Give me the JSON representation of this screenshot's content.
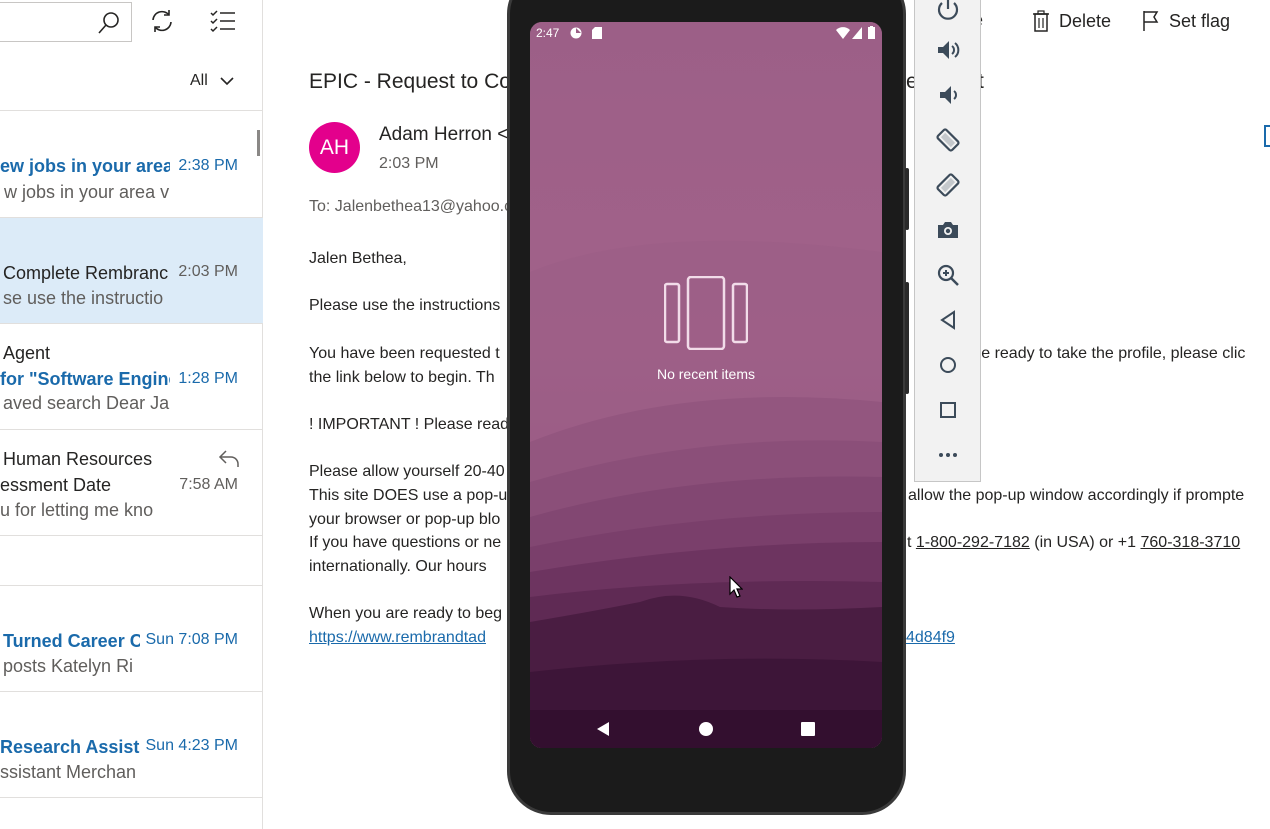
{
  "toolbar": {
    "commands": [
      {
        "label": "ve",
        "icon": "archive-icon"
      },
      {
        "label": "Delete",
        "icon": "trash-icon"
      },
      {
        "label": "Set flag",
        "icon": "flag-icon"
      }
    ]
  },
  "mail_list": {
    "filter_label": "All",
    "items": [
      {
        "line1": "ew jobs in your area",
        "time": "2:38 PM",
        "line2": "w jobs in your area v"
      },
      {
        "line1": "Complete Rembranc",
        "time": "2:03 PM",
        "line2": "se use the instructio",
        "selected": true
      },
      {
        "line0": "Agent",
        "line1": "for \"Software Engine",
        "time": "1:28 PM",
        "line2": "aved search Dear Jale"
      },
      {
        "line0": "Human Resources",
        "line1": "essment Date",
        "time": "7:58 AM",
        "line2": "u for letting me kno"
      },
      {
        "line1": "Turned Career C",
        "time": "Sun 7:08 PM",
        "line2": "posts Katelyn Ri"
      },
      {
        "line1": "Research Assistar",
        "time": "Sun 4:23 PM",
        "line2": "ssistant Merchan"
      }
    ]
  },
  "message": {
    "title": "EPIC - Request to Co",
    "title_tail": "e",
    "title_end": "t",
    "avatar_initials": "AH",
    "from_name": "Adam Herron",
    "from_suffix": "<",
    "time": "2:03 PM",
    "to_label": "To:",
    "to_address": "Jalenbethea13@yahoo.c",
    "greeting": "Jalen Bethea,",
    "p1": "Please use the instructions",
    "p2a": "You have been requested t",
    "p2a_right": "are ready to take the profile, please clic",
    "p2b": "the link below to begin. Th",
    "important": "! IMPORTANT ! Please read",
    "p3a": "Please allow yourself 20-40",
    "p3b": "This site DOES use a pop-u",
    "p3b_right": "allow the pop-up window accordingly if prompte",
    "p3c": "your browser or pop-up blo",
    "p4a": "If you have questions or ne",
    "p4a_t": "t",
    "phone1": "1-800-292-7182",
    "p4a_mid": "(in USA) or +1",
    "phone2": "760-318-3710",
    "p4b": "internationally. Our hours",
    "p5": "When you are ready to beg",
    "link_left": "https://www.rembrandtad",
    "link_right": "4d84f9"
  },
  "phone": {
    "clock": "2:47",
    "recents_text": "No recent items"
  },
  "emulator_toolbar": [
    "power-icon",
    "volume-up-icon",
    "volume-down-icon",
    "rotate-left-icon",
    "rotate-right-icon",
    "camera-icon",
    "zoom-icon",
    "back-icon",
    "home-icon",
    "overview-icon",
    "more-icon"
  ],
  "colors": {
    "accent": "#1a6aab",
    "selected_row": "#dcebf8",
    "avatar": "#e3008c",
    "wallpaper": "#9a5f86"
  }
}
